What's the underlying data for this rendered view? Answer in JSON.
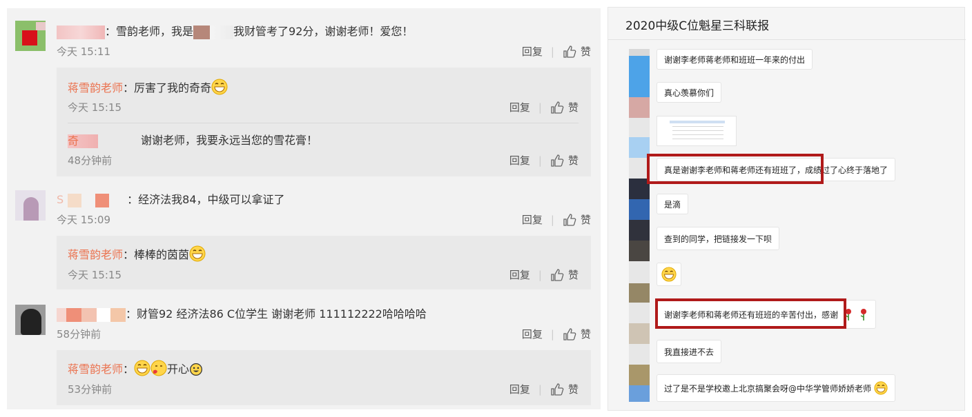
{
  "left": {
    "actions": {
      "reply": "回复",
      "like": "赞"
    },
    "comments": [
      {
        "text_a": "：雪韵老师，我是",
        "text_b": "我财管考了92分，谢谢老师！爱您！",
        "time": "今天 15:11",
        "replies": [
          {
            "name": "蒋雪韵老师",
            "colon": "：",
            "text": "厉害了我的奇奇",
            "time": "今天 15:15"
          },
          {
            "name": "",
            "colon": "",
            "text": "谢谢老师，我要永远当您的雪花膏！",
            "time": "48分钟前",
            "name_prefix": "奇"
          }
        ]
      },
      {
        "text_a": "：经济法我84，中级可以拿证了",
        "time": "今天 15:09",
        "name_prefix": "S",
        "replies": [
          {
            "name": "蒋雪韵老师",
            "colon": "：",
            "text": "棒棒的茵茵",
            "time": "今天 15:15"
          }
        ]
      },
      {
        "text_a": "：财管92 经济法86 C位学生 谢谢老师 111112222哈哈哈哈",
        "time": "58分钟前",
        "replies": [
          {
            "name": "蒋雪韵老师",
            "colon": "：",
            "text": "开心",
            "time": "53分钟前"
          }
        ]
      }
    ]
  },
  "right": {
    "title": "2020中级C位魁星三科联报",
    "messages": [
      {
        "text": "谢谢李老师蒋老师和班班一年来的付出"
      },
      {
        "text": "真心羡慕你们"
      },
      {
        "text": "真是谢谢李老师和蒋老师还有班班了，成绩过了心终于落地了"
      },
      {
        "text": "是滴"
      },
      {
        "text": "查到的同学，把链接发一下呗"
      },
      {
        "text": "谢谢李老师和蒋老师还有班班的辛苦付出，感谢"
      },
      {
        "text": "我直接进不去"
      },
      {
        "text": "过了是不是学校邀上北京搞聚会呀@中华学管师娇娇老师"
      }
    ]
  },
  "colors": {
    "teacher_name": "#eb7350",
    "highlight_box": "#b01a1a",
    "panel_bg": "#f2f2f2",
    "reply_bg": "#e9e9e9"
  },
  "icons": [
    "thumbs-up-icon",
    "grin-emoji-icon",
    "kiss-emoji-icon",
    "smile-emoji-icon",
    "rose-icon"
  ]
}
